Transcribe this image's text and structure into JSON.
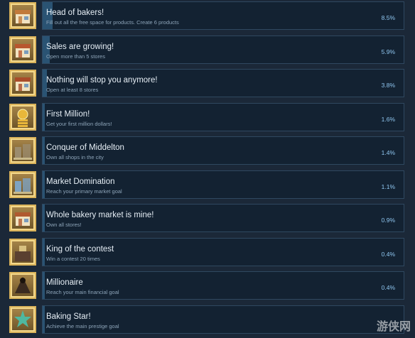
{
  "achievements": [
    {
      "title": "Head of bakers!",
      "description": "Fill out all the free space for products. Create 6 products",
      "percent": "8.5%",
      "unlock_fraction": 0.085,
      "icon": "bakery-plate-icon",
      "icon_color": "#c27a3a"
    },
    {
      "title": "Sales are growing!",
      "description": "Open more than 5 stores",
      "percent": "5.9%",
      "unlock_fraction": 0.059,
      "icon": "bakery-shop-icon",
      "icon_color": "#b8562e"
    },
    {
      "title": "Nothing will stop you anymore!",
      "description": "Open at least 8 stores",
      "percent": "3.8%",
      "unlock_fraction": 0.038,
      "icon": "bakery-shop-icon",
      "icon_color": "#a94c2a"
    },
    {
      "title": "First Million!",
      "description": "Get your first million dollars!",
      "percent": "1.6%",
      "unlock_fraction": 0.016,
      "icon": "gold-coin-stack-icon",
      "icon_color": "#e9b73a"
    },
    {
      "title": "Conquer of Middelton",
      "description": "Own all shops in the city",
      "percent": "1.4%",
      "unlock_fraction": 0.014,
      "icon": "city-buildings-icon",
      "icon_color": "#9c8c6e"
    },
    {
      "title": "Market Domination",
      "description": "Reach your primary market goal",
      "percent": "1.1%",
      "unlock_fraction": 0.011,
      "icon": "market-stalls-icon",
      "icon_color": "#7ea3c2"
    },
    {
      "title": "Whole bakery market is mine!",
      "description": "Own all stores!",
      "percent": "0.9%",
      "unlock_fraction": 0.009,
      "icon": "bakery-shop-coins-icon",
      "icon_color": "#b05a30"
    },
    {
      "title": "King of the contest",
      "description": "Win a contest 20 times",
      "percent": "0.4%",
      "unlock_fraction": 0.004,
      "icon": "podium-icon",
      "icon_color": "#5a4030"
    },
    {
      "title": "Millionaire",
      "description": "Reach your main financial goal",
      "percent": "0.4%",
      "unlock_fraction": 0.004,
      "icon": "dark-figure-icon",
      "icon_color": "#3a2a20"
    },
    {
      "title": "Baking Star!",
      "description": "Achieve the main prestige goal",
      "percent": "",
      "unlock_fraction": 0.0,
      "icon": "star-trophy-icon",
      "icon_color": "#4fb8a0"
    }
  ],
  "watermark": {
    "text": "游侠网"
  }
}
